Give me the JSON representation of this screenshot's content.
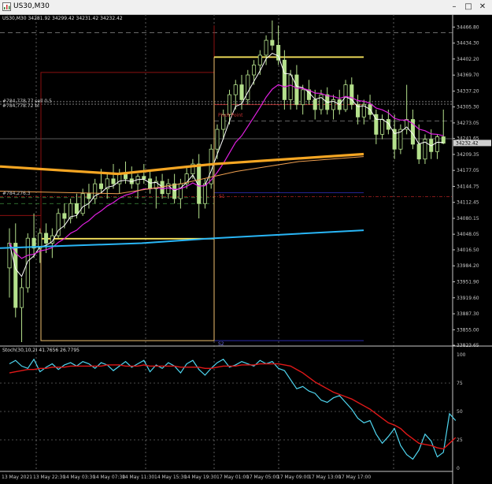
{
  "window": {
    "title": "US30,M30",
    "minimize_glyph": "–",
    "maximize_glyph": "□",
    "close_glyph": "✕"
  },
  "chart_header": "US30,M30  34281.92 34299.42 34231.42 34232.42",
  "stoch_header": "Stoch(30,10,2) 41.7656 26.7795",
  "price_axis": [
    {
      "label": "34466.80",
      "y": 34466.8
    },
    {
      "label": "34434.30",
      "y": 34434.3
    },
    {
      "label": "34402.20",
      "y": 34402.2
    },
    {
      "label": "34369.70",
      "y": 34369.7
    },
    {
      "label": "34337.20",
      "y": 34337.2
    },
    {
      "label": "34305.30",
      "y": 34305.3
    },
    {
      "label": "34273.05",
      "y": 34273.05
    },
    {
      "label": "34241.65",
      "y": 34241.65
    },
    {
      "label": "34209.35",
      "y": 34209.35
    },
    {
      "label": "34177.05",
      "y": 34177.05
    },
    {
      "label": "34144.75",
      "y": 34144.75
    },
    {
      "label": "34112.45",
      "y": 34112.45
    },
    {
      "label": "34080.15",
      "y": 34080.15
    },
    {
      "label": "34048.05",
      "y": 34048.05
    },
    {
      "label": "34016.50",
      "y": 34016.5
    },
    {
      "label": "33984.20",
      "y": 33984.2
    },
    {
      "label": "33951.90",
      "y": 33951.9
    },
    {
      "label": "33919.60",
      "y": 33919.6
    },
    {
      "label": "33887.30",
      "y": 33887.3
    },
    {
      "label": "33855.00",
      "y": 33855.0
    },
    {
      "label": "33823.65",
      "y": 33823.65
    }
  ],
  "current_price_label": "34232.42",
  "stoch_axis": [
    "100",
    "75",
    "50",
    "25",
    "0"
  ],
  "time_axis": [
    "13 May 2021",
    "13 May 22:30",
    "14 May 03:30",
    "14 May 07:30",
    "14 May 11:30",
    "14 May 15:30",
    "14 May 19:30",
    "17 May 01:00",
    "17 May 05:00",
    "17 May 09:00",
    "17 May 13:00",
    "17 May 17:00"
  ],
  "annotations": {
    "pivot_point": "Pivot Point",
    "s1": "S1",
    "s2": "S2",
    "r1_label": "#784,778.77 sell 0.5",
    "r1_sub": "#784,778.72 bl",
    "left_label": "#784,276.3"
  },
  "colors": {
    "candle": "#b4e08c",
    "ma_white": "#ffffff",
    "ma_magenta": "#e020e0",
    "ma_orange_thick": "#f5a623",
    "ma_orange_thin": "#f0a050",
    "ma_blue": "#29b6f6",
    "yellow": "#f7e35c",
    "dark_red": "#8b1010",
    "stoch_main": "#4fd6f0",
    "stoch_signal": "#e01818",
    "pivot_text": "#c23030",
    "navy": "#2a2aa8"
  },
  "chart_data": {
    "type": "candlestick",
    "price_range": [
      33823.65,
      34480
    ],
    "stoch_range": [
      0,
      100
    ],
    "candles": [
      [
        33980,
        34060,
        33920,
        34030
      ],
      [
        34030,
        34070,
        33880,
        33900
      ],
      [
        33900,
        33960,
        33830,
        33940
      ],
      [
        33940,
        34050,
        33930,
        34040
      ],
      [
        34040,
        34090,
        34000,
        34020
      ],
      [
        34020,
        34060,
        33990,
        34050
      ],
      [
        34050,
        34070,
        34010,
        34030
      ],
      [
        34030,
        34060,
        34000,
        34045
      ],
      [
        34045,
        34100,
        34040,
        34090
      ],
      [
        34090,
        34110,
        34060,
        34080
      ],
      [
        34080,
        34120,
        34070,
        34110
      ],
      [
        34110,
        34130,
        34080,
        34090
      ],
      [
        34090,
        34140,
        34085,
        34130
      ],
      [
        34130,
        34150,
        34100,
        34120
      ],
      [
        34120,
        34160,
        34110,
        34150
      ],
      [
        34150,
        34180,
        34130,
        34140
      ],
      [
        34140,
        34170,
        34120,
        34160
      ],
      [
        34160,
        34190,
        34140,
        34150
      ],
      [
        34150,
        34180,
        34130,
        34170
      ],
      [
        34170,
        34195,
        34150,
        34160
      ],
      [
        34160,
        34185,
        34140,
        34150
      ],
      [
        34150,
        34170,
        34120,
        34165
      ],
      [
        34165,
        34190,
        34150,
        34160
      ],
      [
        34160,
        34175,
        34130,
        34140
      ],
      [
        34140,
        34165,
        34100,
        34155
      ],
      [
        34155,
        34170,
        34120,
        34130
      ],
      [
        34130,
        34160,
        34120,
        34150
      ],
      [
        34150,
        34170,
        34110,
        34120
      ],
      [
        34120,
        34160,
        34100,
        34150
      ],
      [
        34150,
        34185,
        34140,
        34170
      ],
      [
        34170,
        34200,
        34160,
        34190
      ],
      [
        34190,
        34210,
        34080,
        34110
      ],
      [
        34110,
        34160,
        34100,
        34150
      ],
      [
        34150,
        34230,
        34140,
        34220
      ],
      [
        34220,
        34270,
        34200,
        34260
      ],
      [
        34260,
        34300,
        34240,
        34290
      ],
      [
        34290,
        34340,
        34270,
        34330
      ],
      [
        34330,
        34360,
        34300,
        34350
      ],
      [
        34350,
        34370,
        34300,
        34320
      ],
      [
        34320,
        34380,
        34310,
        34370
      ],
      [
        34370,
        34400,
        34350,
        34390
      ],
      [
        34390,
        34420,
        34370,
        34410
      ],
      [
        34410,
        34450,
        34390,
        34440
      ],
      [
        34440,
        34480,
        34420,
        34430
      ],
      [
        34430,
        34470,
        34390,
        34400
      ],
      [
        34400,
        34420,
        34300,
        34320
      ],
      [
        34320,
        34380,
        34300,
        34370
      ],
      [
        34370,
        34390,
        34300,
        34310
      ],
      [
        34310,
        34350,
        34290,
        34340
      ],
      [
        34340,
        34360,
        34310,
        34320
      ],
      [
        34320,
        34340,
        34280,
        34300
      ],
      [
        34300,
        34340,
        34290,
        34330
      ],
      [
        34330,
        34345,
        34290,
        34300
      ],
      [
        34300,
        34330,
        34280,
        34320
      ],
      [
        34320,
        34340,
        34290,
        34300
      ],
      [
        34300,
        34360,
        34295,
        34350
      ],
      [
        34350,
        34365,
        34300,
        34310
      ],
      [
        34310,
        34330,
        34270,
        34285
      ],
      [
        34285,
        34320,
        34270,
        34310
      ],
      [
        34310,
        34330,
        34280,
        34290
      ],
      [
        34290,
        34300,
        34230,
        34250
      ],
      [
        34250,
        34290,
        34240,
        34280
      ],
      [
        34280,
        34300,
        34250,
        34260
      ],
      [
        34260,
        34290,
        34200,
        34220
      ],
      [
        34220,
        34270,
        34210,
        34260
      ],
      [
        34260,
        34350,
        34250,
        34280
      ],
      [
        34280,
        34300,
        34220,
        34230
      ],
      [
        34230,
        34270,
        34190,
        34200
      ],
      [
        34200,
        34250,
        34190,
        34240
      ],
      [
        34240,
        34260,
        34200,
        34215
      ],
      [
        34215,
        34250,
        34200,
        34245
      ],
      [
        34245,
        34300,
        34230,
        34232
      ]
    ],
    "stoch_main": [
      92,
      95,
      90,
      88,
      96,
      85,
      89,
      92,
      87,
      91,
      93,
      90,
      94,
      92,
      88,
      93,
      91,
      86,
      90,
      94,
      89,
      92,
      95,
      85,
      91,
      88,
      93,
      90,
      84,
      92,
      95,
      87,
      82,
      88,
      93,
      96,
      89,
      91,
      94,
      92,
      90,
      95,
      92,
      94,
      88,
      86,
      78,
      70,
      72,
      68,
      66,
      60,
      58,
      62,
      64,
      58,
      52,
      44,
      40,
      42,
      30,
      22,
      28,
      35,
      20,
      12,
      8,
      16,
      30,
      24,
      10,
      14,
      48,
      42
    ],
    "stoch_signal": [
      84,
      85,
      86,
      87,
      87,
      88,
      88,
      89,
      89,
      89,
      90,
      90,
      90,
      90,
      90,
      90,
      91,
      91,
      91,
      90,
      90,
      90,
      91,
      90,
      90,
      90,
      90,
      90,
      89,
      89,
      89,
      89,
      88,
      88,
      89,
      90,
      90,
      90,
      91,
      91,
      91,
      92,
      92,
      92,
      92,
      91,
      90,
      87,
      84,
      80,
      76,
      73,
      70,
      67,
      65,
      63,
      61,
      58,
      55,
      52,
      48,
      44,
      40,
      38,
      35,
      30,
      26,
      22,
      21,
      20,
      18,
      17,
      22,
      27
    ]
  }
}
